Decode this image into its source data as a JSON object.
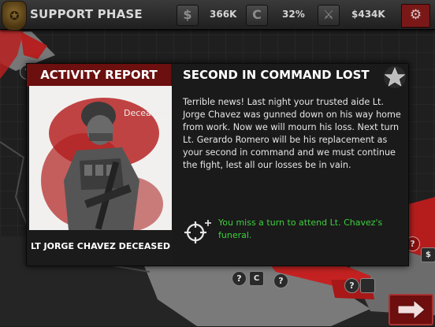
{
  "topbar": {
    "phase": "SUPPORT PHASE",
    "resources": [
      {
        "icon": "money-icon",
        "value": "366K"
      },
      {
        "icon": "support-icon",
        "value": "32%"
      },
      {
        "icon": "weapon-icon",
        "value": "$434K"
      }
    ]
  },
  "dialog": {
    "left_header": "ACTIVITY REPORT",
    "portrait_tag": "Deceased",
    "caption": "LT JORGE CHAVEZ DECEASED",
    "title": "SECOND IN COMMAND LOST",
    "body": "Terrible news! Last night your trusted aide Lt. Jorge Chavez was gunned down on his way home from work. Now we will mourn his loss. Next turn Lt. Gerardo Romero will be his replacement as your second in command and we must continue the fight, lest all our losses be in vain.",
    "penalty": "You miss a turn to attend Lt. Chavez's funeral."
  },
  "map": {
    "question_mark": "?",
    "support_glyph": "C",
    "dollar_glyph": "$"
  },
  "colors": {
    "accent_red": "#6b0f0f",
    "penalty_green": "#3dd13d",
    "land_red": "#b81e1e"
  }
}
